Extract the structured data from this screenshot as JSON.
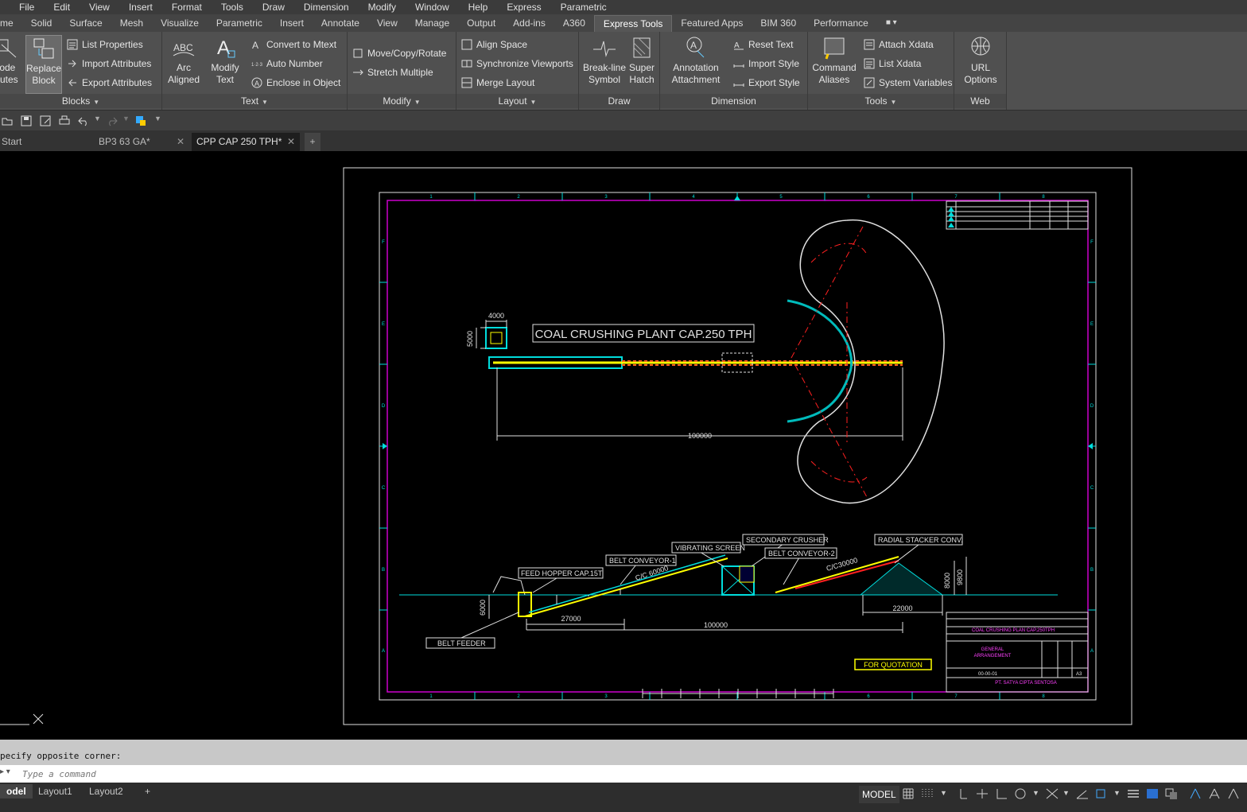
{
  "menubar": [
    "File",
    "Edit",
    "View",
    "Insert",
    "Format",
    "Tools",
    "Draw",
    "Dimension",
    "Modify",
    "Window",
    "Help",
    "Express",
    "Parametric"
  ],
  "ribbon_tabs": [
    "me",
    "Solid",
    "Surface",
    "Mesh",
    "Visualize",
    "Parametric",
    "Insert",
    "Annotate",
    "View",
    "Manage",
    "Output",
    "Add-ins",
    "A360",
    "Express Tools",
    "Featured Apps",
    "BIM 360",
    "Performance"
  ],
  "ribbon_active_tab": "Express Tools",
  "ribbon": {
    "blocks": {
      "title": "Blocks",
      "explode_l1": "lode",
      "explode_l2": "butes",
      "replace_l1": "Replace",
      "replace_l2": "Block",
      "list_properties": "List Properties",
      "import_attributes": "Import Attributes",
      "export_attributes": "Export Attributes"
    },
    "text": {
      "title": "Text",
      "arc_l1": "Arc",
      "arc_l2": "Aligned",
      "modify_l1": "Modify",
      "modify_l2": "Text",
      "convert_mtext": "Convert to Mtext",
      "auto_number": "Auto Number",
      "enclose_object": "Enclose in Object"
    },
    "modify": {
      "title": "Modify",
      "move_copy_rotate": "Move/Copy/Rotate",
      "stretch_multiple": "Stretch Multiple"
    },
    "layout": {
      "title": "Layout",
      "align_space": "Align Space",
      "sync_viewports": "Synchronize Viewports",
      "merge_layout": "Merge Layout"
    },
    "draw": {
      "title": "Draw",
      "breakline_l1": "Break-line",
      "breakline_l2": "Symbol",
      "superhatch_l1": "Super",
      "superhatch_l2": "Hatch"
    },
    "dimension": {
      "title": "Dimension",
      "annotation_l1": "Annotation",
      "annotation_l2": "Attachment",
      "reset_text": "Reset Text",
      "import_style": "Import Style",
      "export_style": "Export Style"
    },
    "tools": {
      "title": "Tools",
      "command_l1": "Command",
      "command_l2": "Aliases",
      "attach_xdata": "Attach Xdata",
      "list_xdata": "List Xdata",
      "system_variables": "System Variables"
    },
    "web": {
      "title": "Web",
      "url_l1": "URL",
      "url_l2": "Options"
    }
  },
  "file_tabs": [
    {
      "label": "Start"
    },
    {
      "label": "BP3 63 GA*"
    },
    {
      "label": "CPP CAP 250 TPH*"
    }
  ],
  "drawing": {
    "title": "COAL  CRUSHING  PLANT  CAP.250  TPH",
    "dim_4000": "4000",
    "dim_5000": "5000",
    "dim_100000_plan": "100000",
    "dim_100000_elev": "100000",
    "dim_27000": "27000",
    "dim_22000": "22000",
    "dim_6000": "6000",
    "dim_8000": "8000",
    "dim_9800": "9800",
    "cc60000": "C/C 60000",
    "cc30000": "C/C30000",
    "labels": {
      "feed_hopper": "FEED  HOPPER  CAP.15T",
      "belt_conveyor_1": "BELT  CONVEYOR-1",
      "vibrating_screen": "VIBRATING  SCREEN",
      "secondary_crusher": "SECONDARY  CRUSHER",
      "belt_conveyor_2": "BELT  CONVEYOR-2",
      "radial_stacker": "RADIAL  STACKER  CONV.",
      "belt_feeder": "BELT  FEEDER"
    },
    "for_quotation": "FOR  QUOTATION",
    "title_block": {
      "project": "COAL  CRUSHING  PLAN  CAP.250TPH",
      "title_l1": "GENERAL",
      "title_l2": "ARRANGEMENT",
      "dwg_no": "00-00-01",
      "size": "A3",
      "company": "PT. SATYA CIPTA SENTOSA"
    },
    "grid_cols": [
      "1",
      "2",
      "3",
      "4",
      "5",
      "6",
      "7",
      "8"
    ],
    "grid_rows": [
      "F",
      "E",
      "D",
      "C",
      "B",
      "A"
    ]
  },
  "command": {
    "history": "pecify opposite corner:",
    "placeholder": "Type a command"
  },
  "layout_tabs": [
    "odel",
    "Layout1",
    "Layout2"
  ],
  "status": {
    "model": "MODEL"
  },
  "colors": {
    "ribbon": "#505050",
    "menubar": "#3b3b3b",
    "drawing_bg": "#000000",
    "magenta": "#cc00cc",
    "yellow": "#ffff00",
    "cyan": "#00ffff",
    "red": "#ff2020"
  }
}
